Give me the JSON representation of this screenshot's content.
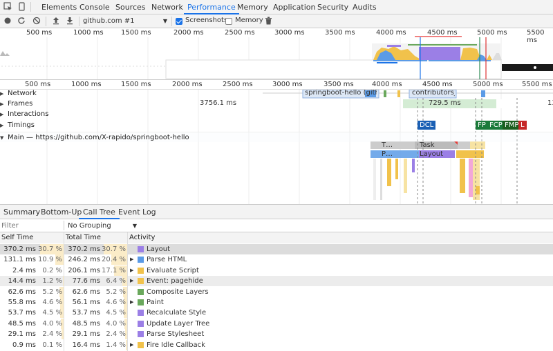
{
  "tabs": [
    "Elements",
    "Console",
    "Sources",
    "Network",
    "Performance",
    "Memory",
    "Application",
    "Security",
    "Audits"
  ],
  "active_tab": "Performance",
  "toolbar": {
    "url_select": "github.com #1",
    "screenshots_label": "Screenshots",
    "memory_label": "Memory",
    "screenshots_checked": true,
    "memory_checked": false
  },
  "overview_ticks": [
    "500 ms",
    "1000 ms",
    "1500 ms",
    "2000 ms",
    "2500 ms",
    "3000 ms",
    "3500 ms",
    "4000 ms",
    "4500 ms",
    "5000 ms",
    "5500 ms"
  ],
  "main_ticks": [
    "500 ms",
    "1000 ms",
    "1500 ms",
    "2000 ms",
    "2500 ms",
    "3000 ms",
    "3500 ms",
    "4000 ms",
    "4500 ms",
    "5000 ms",
    "5500 ms"
  ],
  "tracks": {
    "network": "Network",
    "frames": "Frames",
    "interactions": "Interactions",
    "timings": "Timings",
    "main": "Main — https://github.com/X-rapido/springboot-hello"
  },
  "network_items": [
    "springboot-hello (gith…",
    "contributors_…"
  ],
  "frames": [
    "3756.1 ms",
    "729.5 ms",
    "13"
  ],
  "timings": [
    "DCL",
    "FP",
    "FCP",
    "FMP",
    "L"
  ],
  "flame": [
    "T…",
    "Task",
    "P…",
    "Layout"
  ],
  "bottom_tabs": [
    "Summary",
    "Bottom-Up",
    "Call Tree",
    "Event Log"
  ],
  "active_bottom_tab": "Call Tree",
  "filter_placeholder": "Filter",
  "grouping": "No Grouping",
  "columns": [
    "Self Time",
    "Total Time",
    "Activity"
  ],
  "rows": [
    {
      "self": "370.2 ms",
      "self_pct": "30.7 %",
      "total": "370.2 ms",
      "total_pct": "30.7 %",
      "activity": "Layout",
      "color": "#9b7fe6",
      "expandable": false
    },
    {
      "self": "131.1 ms",
      "self_pct": "10.9 %",
      "total": "246.2 ms",
      "total_pct": "20.4 %",
      "activity": "Parse HTML",
      "color": "#5b9be6",
      "expandable": true
    },
    {
      "self": "2.4 ms",
      "self_pct": "0.2 %",
      "total": "206.1 ms",
      "total_pct": "17.1 %",
      "activity": "Evaluate Script",
      "color": "#f1c24b",
      "expandable": true
    },
    {
      "self": "14.4 ms",
      "self_pct": "1.2 %",
      "total": "77.6 ms",
      "total_pct": "6.4 %",
      "activity": "Event: pagehide",
      "color": "#f1c24b",
      "expandable": true
    },
    {
      "self": "62.6 ms",
      "self_pct": "5.2 %",
      "total": "62.6 ms",
      "total_pct": "5.2 %",
      "activity": "Composite Layers",
      "color": "#6aa85c",
      "expandable": false
    },
    {
      "self": "55.8 ms",
      "self_pct": "4.6 %",
      "total": "56.1 ms",
      "total_pct": "4.6 %",
      "activity": "Paint",
      "color": "#6aa85c",
      "expandable": true
    },
    {
      "self": "53.7 ms",
      "self_pct": "4.5 %",
      "total": "53.7 ms",
      "total_pct": "4.5 %",
      "activity": "Recalculate Style",
      "color": "#9b7fe6",
      "expandable": false
    },
    {
      "self": "48.5 ms",
      "self_pct": "4.0 %",
      "total": "48.5 ms",
      "total_pct": "4.0 %",
      "activity": "Update Layer Tree",
      "color": "#9b7fe6",
      "expandable": false
    },
    {
      "self": "29.1 ms",
      "self_pct": "2.4 %",
      "total": "29.1 ms",
      "total_pct": "2.4 %",
      "activity": "Parse Stylesheet",
      "color": "#9b7fe6",
      "expandable": false
    },
    {
      "self": "0.9 ms",
      "self_pct": "0.1 %",
      "total": "16.4 ms",
      "total_pct": "1.4 %",
      "activity": "Fire Idle Callback",
      "color": "#f1c24b",
      "expandable": true
    }
  ]
}
